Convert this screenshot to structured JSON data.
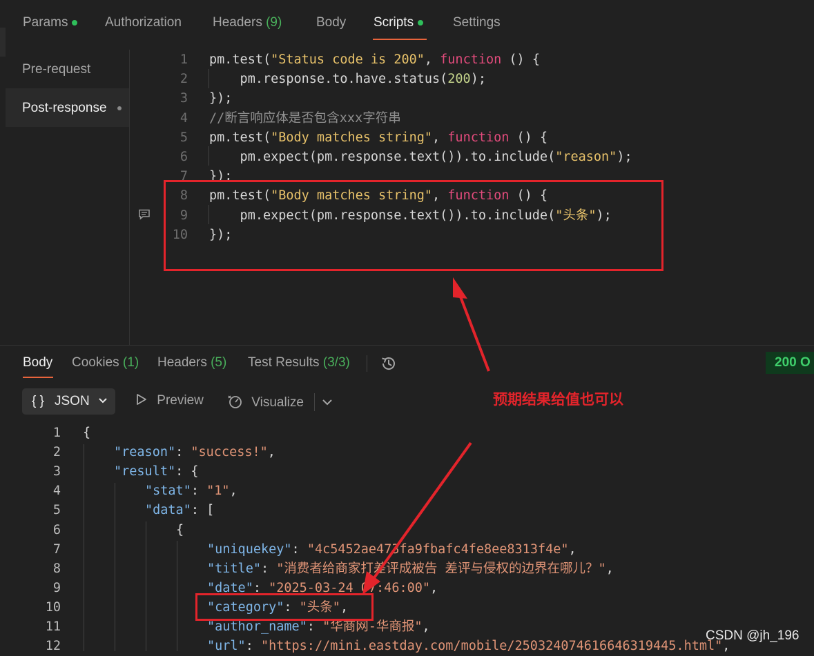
{
  "request_tabs": [
    {
      "label": "Params",
      "dot": true
    },
    {
      "label": "Authorization"
    },
    {
      "label": "Headers ",
      "count": "(9)"
    },
    {
      "label": "Body"
    },
    {
      "label": "Scripts",
      "dot": true,
      "active": true
    },
    {
      "label": "Settings"
    }
  ],
  "script_tabs": [
    {
      "label": "Pre-request"
    },
    {
      "label": "Post-response",
      "active": true
    }
  ],
  "script_lines": [
    {
      "n": "1",
      "tokens": [
        {
          "t": "pm.test(",
          "c": "plain"
        },
        {
          "t": "\"Status code is 200\"",
          "c": "str"
        },
        {
          "t": ", ",
          "c": "plain"
        },
        {
          "t": "function",
          "c": "fn"
        },
        {
          "t": " () {",
          "c": "plain"
        }
      ]
    },
    {
      "n": "2",
      "tokens": [
        {
          "t": "    pm.response.to.have.status(",
          "c": "plain"
        },
        {
          "t": "200",
          "c": "num"
        },
        {
          "t": ");",
          "c": "plain"
        }
      ]
    },
    {
      "n": "3",
      "tokens": [
        {
          "t": "});",
          "c": "plain"
        }
      ]
    },
    {
      "n": "4",
      "tokens": [
        {
          "t": "//断言响应体是否包含xxx字符串",
          "c": "cm"
        }
      ]
    },
    {
      "n": "5",
      "tokens": [
        {
          "t": "pm.test(",
          "c": "plain"
        },
        {
          "t": "\"Body matches string\"",
          "c": "str"
        },
        {
          "t": ", ",
          "c": "plain"
        },
        {
          "t": "function",
          "c": "fn"
        },
        {
          "t": " () {",
          "c": "plain"
        }
      ]
    },
    {
      "n": "6",
      "tokens": [
        {
          "t": "    pm.expect(pm.response.text()).to.include(",
          "c": "plain"
        },
        {
          "t": "\"reason\"",
          "c": "str"
        },
        {
          "t": ");",
          "c": "plain"
        }
      ]
    },
    {
      "n": "7",
      "tokens": [
        {
          "t": "});",
          "c": "plain"
        }
      ]
    },
    {
      "n": "8",
      "tokens": [
        {
          "t": "pm.test(",
          "c": "plain"
        },
        {
          "t": "\"Body matches string\"",
          "c": "str"
        },
        {
          "t": ", ",
          "c": "plain"
        },
        {
          "t": "function",
          "c": "fn"
        },
        {
          "t": " () {",
          "c": "plain"
        }
      ]
    },
    {
      "n": "9",
      "tokens": [
        {
          "t": "    pm.expect(pm.response.text()).to.include(",
          "c": "plain"
        },
        {
          "t": "\"头条\"",
          "c": "str"
        },
        {
          "t": ");",
          "c": "plain"
        }
      ]
    },
    {
      "n": "10",
      "tokens": [
        {
          "t": "});",
          "c": "plain"
        }
      ]
    }
  ],
  "response_tabs": [
    {
      "label": "Body",
      "active": true
    },
    {
      "label": "Cookies ",
      "count": "(1)"
    },
    {
      "label": "Headers ",
      "count": "(5)"
    },
    {
      "label": "Test Results ",
      "count": "(3/3)"
    }
  ],
  "status": "200 O",
  "view": {
    "format": "JSON",
    "braces": "{ }",
    "preview": "Preview",
    "visualize": "Visualize"
  },
  "json_lines": [
    {
      "n": "1",
      "indent": 0,
      "tokens": [
        {
          "t": "{",
          "c": "pun"
        }
      ]
    },
    {
      "n": "2",
      "indent": 1,
      "tokens": [
        {
          "t": "\"reason\"",
          "c": "key"
        },
        {
          "t": ": ",
          "c": "pun"
        },
        {
          "t": "\"success!\"",
          "c": "str"
        },
        {
          "t": ",",
          "c": "pun"
        }
      ]
    },
    {
      "n": "3",
      "indent": 1,
      "tokens": [
        {
          "t": "\"result\"",
          "c": "key"
        },
        {
          "t": ": {",
          "c": "pun"
        }
      ]
    },
    {
      "n": "4",
      "indent": 2,
      "tokens": [
        {
          "t": "\"stat\"",
          "c": "key"
        },
        {
          "t": ": ",
          "c": "pun"
        },
        {
          "t": "\"1\"",
          "c": "str"
        },
        {
          "t": ",",
          "c": "pun"
        }
      ]
    },
    {
      "n": "5",
      "indent": 2,
      "tokens": [
        {
          "t": "\"data\"",
          "c": "key"
        },
        {
          "t": ": [",
          "c": "pun"
        }
      ]
    },
    {
      "n": "6",
      "indent": 3,
      "tokens": [
        {
          "t": "{",
          "c": "pun"
        }
      ]
    },
    {
      "n": "7",
      "indent": 4,
      "tokens": [
        {
          "t": "\"uniquekey\"",
          "c": "key"
        },
        {
          "t": ": ",
          "c": "pun"
        },
        {
          "t": "\"4c5452ae473fa9fbafc4fe8ee8313f4e\"",
          "c": "str"
        },
        {
          "t": ",",
          "c": "pun"
        }
      ]
    },
    {
      "n": "8",
      "indent": 4,
      "tokens": [
        {
          "t": "\"title\"",
          "c": "key"
        },
        {
          "t": ": ",
          "c": "pun"
        },
        {
          "t": "\"消费者给商家打差评成被告 差评与侵权的边界在哪儿？\"",
          "c": "str"
        },
        {
          "t": ",",
          "c": "pun"
        }
      ]
    },
    {
      "n": "9",
      "indent": 4,
      "tokens": [
        {
          "t": "\"date\"",
          "c": "key"
        },
        {
          "t": ": ",
          "c": "pun"
        },
        {
          "t": "\"2025-03-24 07:46:00\"",
          "c": "str"
        },
        {
          "t": ",",
          "c": "pun"
        }
      ]
    },
    {
      "n": "10",
      "indent": 4,
      "tokens": [
        {
          "t": "\"category\"",
          "c": "key"
        },
        {
          "t": ": ",
          "c": "pun"
        },
        {
          "t": "\"头条\"",
          "c": "str"
        },
        {
          "t": ",",
          "c": "pun"
        }
      ]
    },
    {
      "n": "11",
      "indent": 4,
      "tokens": [
        {
          "t": "\"author_name\"",
          "c": "key"
        },
        {
          "t": ": ",
          "c": "pun"
        },
        {
          "t": "\"华商网-华商报\"",
          "c": "str"
        },
        {
          "t": ",",
          "c": "pun"
        }
      ]
    },
    {
      "n": "12",
      "indent": 4,
      "tokens": [
        {
          "t": "\"url\"",
          "c": "key"
        },
        {
          "t": ": ",
          "c": "pun"
        },
        {
          "t": "\"https://mini.eastday.com/mobile/250324074616646319445.html\"",
          "c": "str"
        },
        {
          "t": ",",
          "c": "pun"
        }
      ]
    }
  ],
  "annotation": "预期结果给值也可以",
  "watermark": "CSDN @jh_196",
  "colors": {
    "accent": "#e8643c",
    "success": "#2fbf5b",
    "annotation": "#e3242b"
  }
}
